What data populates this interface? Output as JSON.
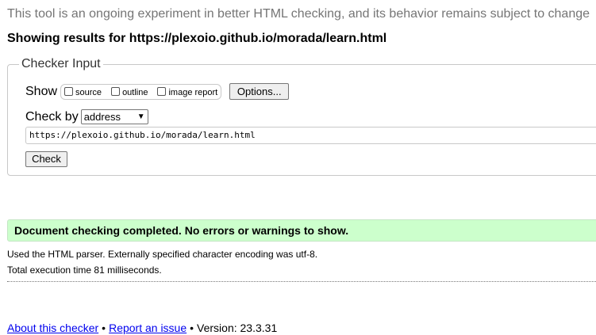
{
  "intro_text": "This tool is an ongoing experiment in better HTML checking, and its behavior remains subject to change",
  "results_title": "Showing results for https://plexoio.github.io/morada/learn.html",
  "checker_input": {
    "legend": "Checker Input",
    "show_label": "Show",
    "show_options": {
      "source": "source",
      "outline": "outline",
      "image_report": "image report"
    },
    "options_button": "Options...",
    "check_by_label": "Check by",
    "check_by_selected": "address",
    "address_value": "https://plexoio.github.io/morada/learn.html",
    "check_button": "Check"
  },
  "result": {
    "message": "Document checking completed. No errors or warnings to show.",
    "parser_note": "Used the HTML parser. Externally specified character encoding was utf-8.",
    "execution_time": "Total execution time 81 milliseconds."
  },
  "footer": {
    "about_link": "About this checker",
    "sep1": "•",
    "report_link": "Report an issue",
    "sep2": "•",
    "version": "Version: 23.3.31"
  },
  "colors": {
    "success_background": "#ccffcc",
    "link": "#0000ee",
    "intro_text": "#757575"
  },
  "icons": {
    "select_arrow": "chevron-down-icon"
  }
}
